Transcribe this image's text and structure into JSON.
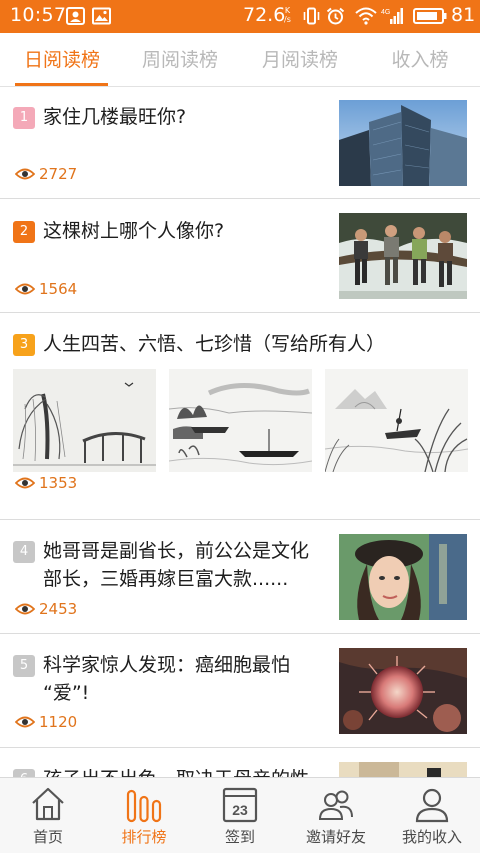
{
  "status_bar": {
    "time": "10:57",
    "speed": "72.6",
    "speed_unit_top": "K",
    "speed_unit_bottom": "/s",
    "network": "4G",
    "battery": "81"
  },
  "tabs": [
    {
      "label": "日阅读榜",
      "active": true
    },
    {
      "label": "周阅读榜",
      "active": false
    },
    {
      "label": "月阅读榜",
      "active": false
    },
    {
      "label": "收入榜",
      "active": false
    }
  ],
  "articles": [
    {
      "rank": "1",
      "title_lines": [
        "家住几楼最旺你?"
      ],
      "views": "2727",
      "thumb": "skyscrapers"
    },
    {
      "rank": "2",
      "title_lines": [
        "这棵树上哪个人像你?"
      ],
      "views": "1564",
      "thumb": "people-in-tree"
    },
    {
      "rank": "3",
      "title_lines": [
        "人生四苦、六悟、七珍惜（写给所有人）"
      ],
      "views": "1353",
      "thumb": "ink-paintings"
    },
    {
      "rank": "4",
      "title_lines": [
        "她哥哥是副省长，前公公是文化",
        "部长，三婚再嫁巨富大款......"
      ],
      "views": "2453",
      "thumb": "woman-portrait"
    },
    {
      "rank": "5",
      "title_lines": [
        "科学家惊人发现：癌细胞最怕",
        "“爱”!"
      ],
      "views": "1120",
      "thumb": "cancer-cell"
    },
    {
      "rank": "6",
      "title_lines": [
        "孩子出不出色，取决于母亲的性"
      ],
      "views": "",
      "thumb": "painting"
    }
  ],
  "bottom_nav": [
    {
      "label": "首页",
      "icon": "home-icon",
      "active": false
    },
    {
      "label": "排行榜",
      "icon": "ranking-icon",
      "active": true
    },
    {
      "label": "签到",
      "icon": "calendar-icon",
      "active": false,
      "icon_text": "23"
    },
    {
      "label": "邀请好友",
      "icon": "invite-friends-icon",
      "active": false
    },
    {
      "label": "我的收入",
      "icon": "profile-icon",
      "active": false
    }
  ],
  "colors": {
    "brand_orange": "#f07417",
    "rank1": "#f4a9b8",
    "rank2": "#f07417",
    "rank3": "#f7a21b",
    "rank_other": "#c7c7c7",
    "views_text": "#e0741c"
  }
}
